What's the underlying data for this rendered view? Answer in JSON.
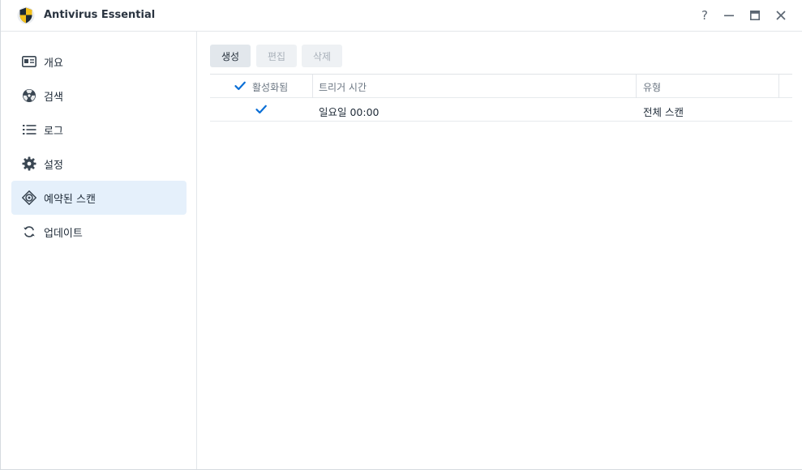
{
  "window": {
    "title": "Antivirus Essential",
    "controls": {
      "help": "?",
      "minimize_icon": "minimize-icon",
      "maximize_icon": "maximize-icon",
      "close_icon": "close-icon"
    }
  },
  "sidebar": {
    "items": [
      {
        "label": "개요",
        "icon": "overview-card-icon",
        "active": false
      },
      {
        "label": "검색",
        "icon": "scan-radiation-icon",
        "active": false
      },
      {
        "label": "로그",
        "icon": "list-icon",
        "active": false
      },
      {
        "label": "설정",
        "icon": "gear-icon",
        "active": false
      },
      {
        "label": "예약된 스캔",
        "icon": "target-icon",
        "active": true
      },
      {
        "label": "업데이트",
        "icon": "refresh-icon",
        "active": false
      }
    ]
  },
  "toolbar": {
    "create_label": "생성",
    "edit_label": "편집",
    "delete_label": "삭제",
    "edit_enabled": false,
    "delete_enabled": false
  },
  "table": {
    "columns": [
      "활성화됨",
      "트리거 시간",
      "유형"
    ],
    "header_checkbox_checked": true,
    "rows": [
      {
        "enabled": true,
        "trigger_time": "일요일 00:00",
        "type": "전체 스캔"
      }
    ]
  },
  "colors": {
    "accent": "#0b6fd6",
    "active_nav_bg": "#e5f0fb",
    "logo_yellow": "#f3c01b",
    "logo_dark": "#1d2935"
  }
}
